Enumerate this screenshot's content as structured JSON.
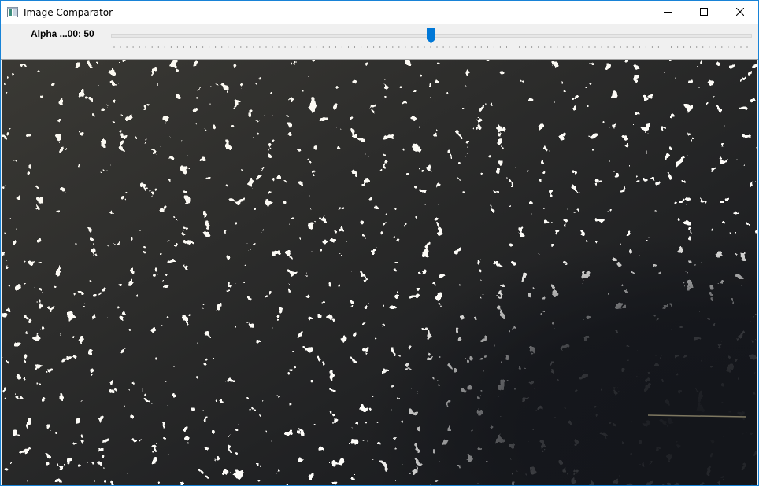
{
  "window": {
    "title": "Image Comparator",
    "app_icon": "window-icon",
    "controls": {
      "minimize_icon": "minimize-icon",
      "maximize_icon": "maximize-icon",
      "close_icon": "close-icon"
    }
  },
  "trackbar": {
    "label": "Alpha ...00: 50",
    "value": 50,
    "min": 0,
    "max": 100,
    "accent_color": "#0078d7"
  },
  "image": {
    "description_icon": "comparison-image",
    "foreground_color": "#fdfdfb",
    "background_color": "#14161b",
    "tint_color": "#e8d9a8"
  }
}
